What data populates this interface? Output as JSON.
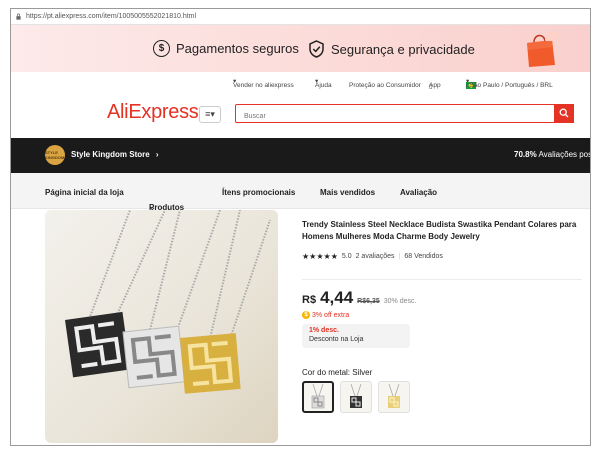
{
  "browser": {
    "url": "https://pt.aliexpress.com/item/1005005552021810.html"
  },
  "promo": {
    "item1": "Pagamentos seguros",
    "item2": "Segurança e privacidade",
    "icon1": "dollar-shield-icon",
    "icon2": "check-shield-icon"
  },
  "topnav": {
    "sell": "Vender no aliexpress",
    "help": "Ajuda",
    "protection": "Proteção ao Consumidor",
    "app": "App",
    "locale": "/ São Paulo / Português / BRL"
  },
  "header": {
    "logo": "AliExpress",
    "menu_label": "≡▾",
    "search_placeholder": "Buscar"
  },
  "store": {
    "logo_text": "STYLE KINGDOM",
    "name": "Style Kingdom Store",
    "positive_pct": "70.8%",
    "positive_label": " Avaliações pos"
  },
  "store_nav": [
    "Página inicial da loja",
    "Produtos",
    "Ítens promocionais",
    "Mais vendidos",
    "Avaliação"
  ],
  "product": {
    "title": "Trendy Stainless Steel Necklace Budista Swastika Pendant Colares para Homens Mulheres Moda Charme Body Jewelry",
    "stars": "★★★★★",
    "rating": "5.0",
    "reviews": "2 avaliações",
    "sold": "68 Vendidos",
    "currency": "R$",
    "price": "4,44",
    "old_price": "R$6,35",
    "discount": "30% desc.",
    "extra_off": "3% off extra",
    "coupon_pct": "1% desc.",
    "coupon_text": "Desconto na Loja",
    "variant_label": "Cor do metal: Silver"
  }
}
